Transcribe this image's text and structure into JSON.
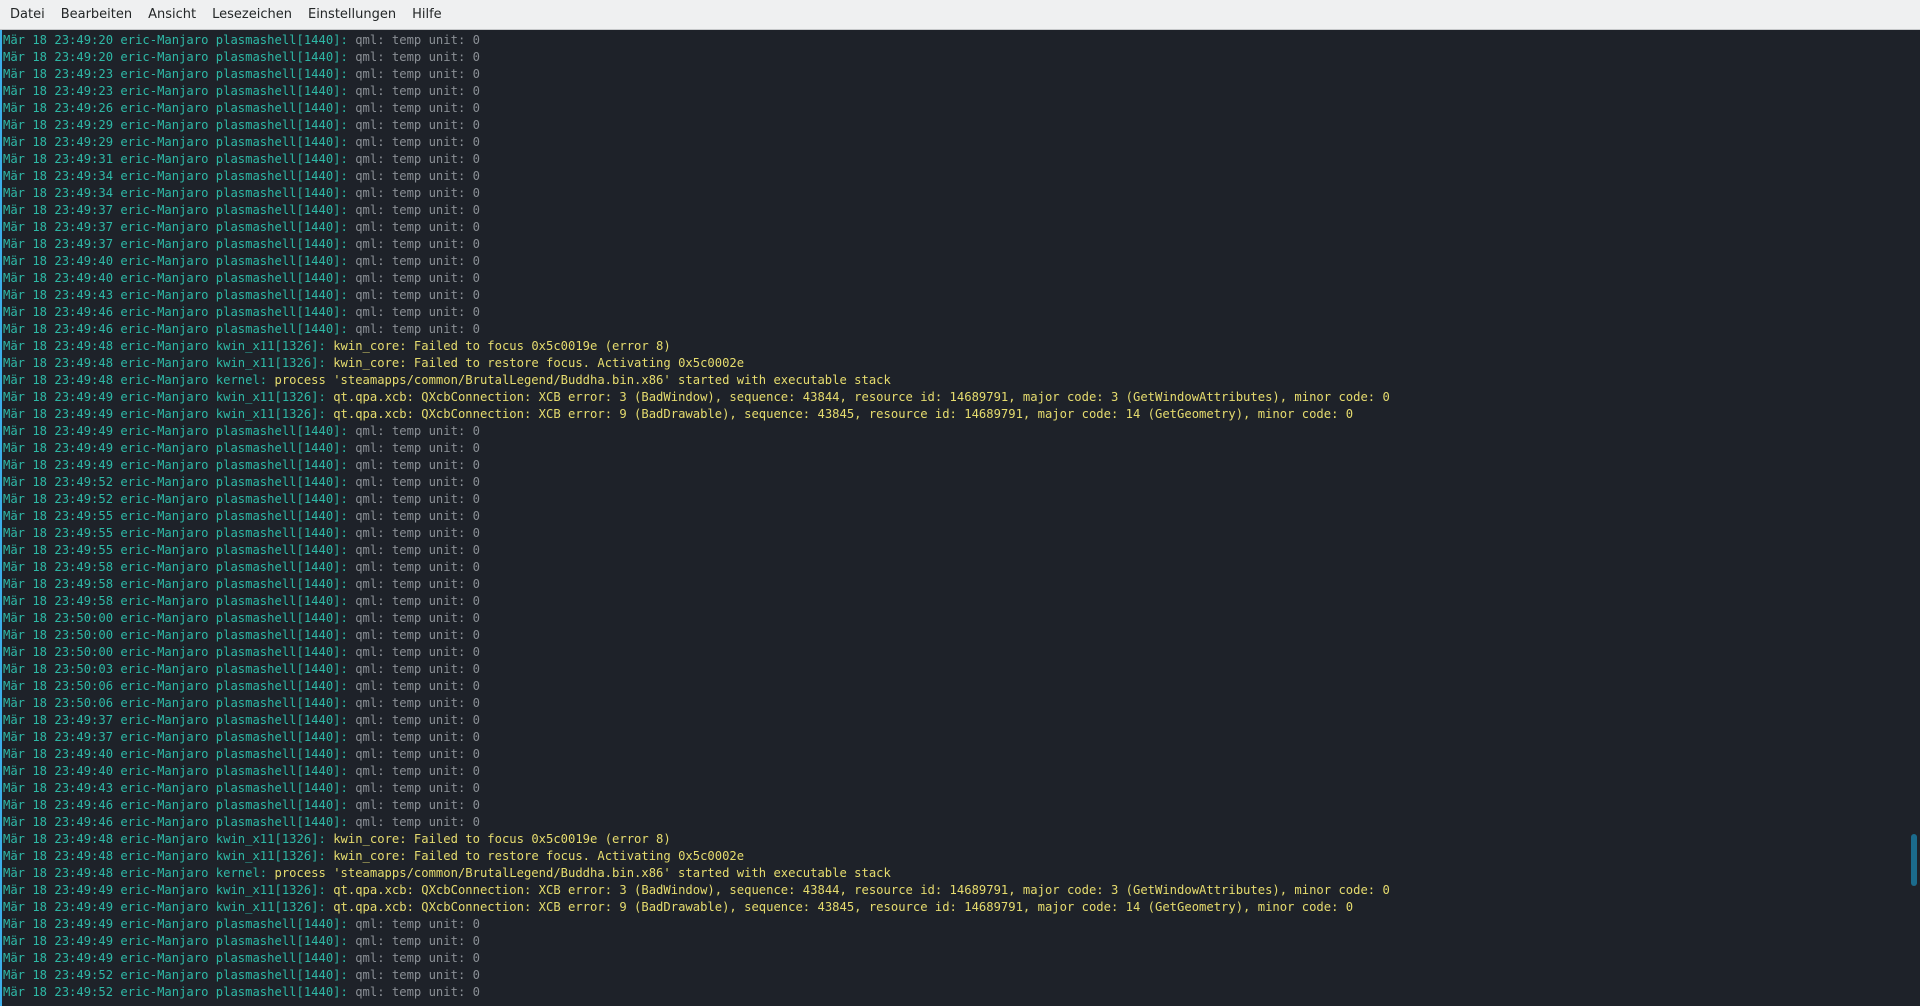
{
  "menubar": {
    "items": [
      "Datei",
      "Bearbeiten",
      "Ansicht",
      "Lesezeichen",
      "Einstellungen",
      "Hilfe"
    ]
  },
  "colors": {
    "background": "#1e2229",
    "host": "#2eb8a6",
    "info": "#8a8f95",
    "warning": "#e6dc6e"
  },
  "log_lines": [
    {
      "prefix": "Mär 18 23:49:20 eric-Manjaro plasmashell[1440]:",
      "msg": "qml: temp unit: 0",
      "level": "info"
    },
    {
      "prefix": "Mär 18 23:49:20 eric-Manjaro plasmashell[1440]:",
      "msg": "qml: temp unit: 0",
      "level": "info"
    },
    {
      "prefix": "Mär 18 23:49:23 eric-Manjaro plasmashell[1440]:",
      "msg": "qml: temp unit: 0",
      "level": "info"
    },
    {
      "prefix": "Mär 18 23:49:23 eric-Manjaro plasmashell[1440]:",
      "msg": "qml: temp unit: 0",
      "level": "info"
    },
    {
      "prefix": "Mär 18 23:49:26 eric-Manjaro plasmashell[1440]:",
      "msg": "qml: temp unit: 0",
      "level": "info"
    },
    {
      "prefix": "Mär 18 23:49:29 eric-Manjaro plasmashell[1440]:",
      "msg": "qml: temp unit: 0",
      "level": "info"
    },
    {
      "prefix": "Mär 18 23:49:29 eric-Manjaro plasmashell[1440]:",
      "msg": "qml: temp unit: 0",
      "level": "info"
    },
    {
      "prefix": "Mär 18 23:49:31 eric-Manjaro plasmashell[1440]:",
      "msg": "qml: temp unit: 0",
      "level": "info"
    },
    {
      "prefix": "Mär 18 23:49:34 eric-Manjaro plasmashell[1440]:",
      "msg": "qml: temp unit: 0",
      "level": "info"
    },
    {
      "prefix": "Mär 18 23:49:34 eric-Manjaro plasmashell[1440]:",
      "msg": "qml: temp unit: 0",
      "level": "info"
    },
    {
      "prefix": "Mär 18 23:49:37 eric-Manjaro plasmashell[1440]:",
      "msg": "qml: temp unit: 0",
      "level": "info"
    },
    {
      "prefix": "Mär 18 23:49:37 eric-Manjaro plasmashell[1440]:",
      "msg": "qml: temp unit: 0",
      "level": "info"
    },
    {
      "prefix": "Mär 18 23:49:37 eric-Manjaro plasmashell[1440]:",
      "msg": "qml: temp unit: 0",
      "level": "info"
    },
    {
      "prefix": "Mär 18 23:49:40 eric-Manjaro plasmashell[1440]:",
      "msg": "qml: temp unit: 0",
      "level": "info"
    },
    {
      "prefix": "Mär 18 23:49:40 eric-Manjaro plasmashell[1440]:",
      "msg": "qml: temp unit: 0",
      "level": "info"
    },
    {
      "prefix": "Mär 18 23:49:43 eric-Manjaro plasmashell[1440]:",
      "msg": "qml: temp unit: 0",
      "level": "info"
    },
    {
      "prefix": "Mär 18 23:49:46 eric-Manjaro plasmashell[1440]:",
      "msg": "qml: temp unit: 0",
      "level": "info"
    },
    {
      "prefix": "Mär 18 23:49:46 eric-Manjaro plasmashell[1440]:",
      "msg": "qml: temp unit: 0",
      "level": "info"
    },
    {
      "prefix": "Mär 18 23:49:48 eric-Manjaro kwin_x11[1326]:",
      "msg": "kwin_core: Failed to focus 0x5c0019e (error 8)",
      "level": "warn"
    },
    {
      "prefix": "Mär 18 23:49:48 eric-Manjaro kwin_x11[1326]:",
      "msg": "kwin_core: Failed to restore focus. Activating 0x5c0002e",
      "level": "warn"
    },
    {
      "prefix": "Mär 18 23:49:48 eric-Manjaro kernel:",
      "msg": "process 'steamapps/common/BrutalLegend/Buddha.bin.x86' started with executable stack",
      "level": "warn"
    },
    {
      "prefix": "Mär 18 23:49:49 eric-Manjaro kwin_x11[1326]:",
      "msg": "qt.qpa.xcb: QXcbConnection: XCB error: 3 (BadWindow), sequence: 43844, resource id: 14689791, major code: 3 (GetWindowAttributes), minor code: 0",
      "level": "warn"
    },
    {
      "prefix": "Mär 18 23:49:49 eric-Manjaro kwin_x11[1326]:",
      "msg": "qt.qpa.xcb: QXcbConnection: XCB error: 9 (BadDrawable), sequence: 43845, resource id: 14689791, major code: 14 (GetGeometry), minor code: 0",
      "level": "warn"
    },
    {
      "prefix": "Mär 18 23:49:49 eric-Manjaro plasmashell[1440]:",
      "msg": "qml: temp unit: 0",
      "level": "info"
    },
    {
      "prefix": "Mär 18 23:49:49 eric-Manjaro plasmashell[1440]:",
      "msg": "qml: temp unit: 0",
      "level": "info"
    },
    {
      "prefix": "Mär 18 23:49:49 eric-Manjaro plasmashell[1440]:",
      "msg": "qml: temp unit: 0",
      "level": "info"
    },
    {
      "prefix": "Mär 18 23:49:52 eric-Manjaro plasmashell[1440]:",
      "msg": "qml: temp unit: 0",
      "level": "info"
    },
    {
      "prefix": "Mär 18 23:49:52 eric-Manjaro plasmashell[1440]:",
      "msg": "qml: temp unit: 0",
      "level": "info"
    },
    {
      "prefix": "Mär 18 23:49:55 eric-Manjaro plasmashell[1440]:",
      "msg": "qml: temp unit: 0",
      "level": "info"
    },
    {
      "prefix": "Mär 18 23:49:55 eric-Manjaro plasmashell[1440]:",
      "msg": "qml: temp unit: 0",
      "level": "info"
    },
    {
      "prefix": "Mär 18 23:49:55 eric-Manjaro plasmashell[1440]:",
      "msg": "qml: temp unit: 0",
      "level": "info"
    },
    {
      "prefix": "Mär 18 23:49:58 eric-Manjaro plasmashell[1440]:",
      "msg": "qml: temp unit: 0",
      "level": "info"
    },
    {
      "prefix": "Mär 18 23:49:58 eric-Manjaro plasmashell[1440]:",
      "msg": "qml: temp unit: 0",
      "level": "info"
    },
    {
      "prefix": "Mär 18 23:49:58 eric-Manjaro plasmashell[1440]:",
      "msg": "qml: temp unit: 0",
      "level": "info"
    },
    {
      "prefix": "Mär 18 23:50:00 eric-Manjaro plasmashell[1440]:",
      "msg": "qml: temp unit: 0",
      "level": "info"
    },
    {
      "prefix": "Mär 18 23:50:00 eric-Manjaro plasmashell[1440]:",
      "msg": "qml: temp unit: 0",
      "level": "info"
    },
    {
      "prefix": "Mär 18 23:50:00 eric-Manjaro plasmashell[1440]:",
      "msg": "qml: temp unit: 0",
      "level": "info"
    },
    {
      "prefix": "Mär 18 23:50:03 eric-Manjaro plasmashell[1440]:",
      "msg": "qml: temp unit: 0",
      "level": "info"
    },
    {
      "prefix": "Mär 18 23:50:06 eric-Manjaro plasmashell[1440]:",
      "msg": "qml: temp unit: 0",
      "level": "info"
    },
    {
      "prefix": "Mär 18 23:50:06 eric-Manjaro plasmashell[1440]:",
      "msg": "qml: temp unit: 0",
      "level": "info"
    },
    {
      "prefix": "Mär 18 23:49:37 eric-Manjaro plasmashell[1440]:",
      "msg": "qml: temp unit: 0",
      "level": "info"
    },
    {
      "prefix": "Mär 18 23:49:37 eric-Manjaro plasmashell[1440]:",
      "msg": "qml: temp unit: 0",
      "level": "info"
    },
    {
      "prefix": "Mär 18 23:49:40 eric-Manjaro plasmashell[1440]:",
      "msg": "qml: temp unit: 0",
      "level": "info"
    },
    {
      "prefix": "Mär 18 23:49:40 eric-Manjaro plasmashell[1440]:",
      "msg": "qml: temp unit: 0",
      "level": "info"
    },
    {
      "prefix": "Mär 18 23:49:43 eric-Manjaro plasmashell[1440]:",
      "msg": "qml: temp unit: 0",
      "level": "info"
    },
    {
      "prefix": "Mär 18 23:49:46 eric-Manjaro plasmashell[1440]:",
      "msg": "qml: temp unit: 0",
      "level": "info"
    },
    {
      "prefix": "Mär 18 23:49:46 eric-Manjaro plasmashell[1440]:",
      "msg": "qml: temp unit: 0",
      "level": "info"
    },
    {
      "prefix": "Mär 18 23:49:48 eric-Manjaro kwin_x11[1326]:",
      "msg": "kwin_core: Failed to focus 0x5c0019e (error 8)",
      "level": "warn"
    },
    {
      "prefix": "Mär 18 23:49:48 eric-Manjaro kwin_x11[1326]:",
      "msg": "kwin_core: Failed to restore focus. Activating 0x5c0002e",
      "level": "warn"
    },
    {
      "prefix": "Mär 18 23:49:48 eric-Manjaro kernel:",
      "msg": "process 'steamapps/common/BrutalLegend/Buddha.bin.x86' started with executable stack",
      "level": "warn"
    },
    {
      "prefix": "Mär 18 23:49:49 eric-Manjaro kwin_x11[1326]:",
      "msg": "qt.qpa.xcb: QXcbConnection: XCB error: 3 (BadWindow), sequence: 43844, resource id: 14689791, major code: 3 (GetWindowAttributes), minor code: 0",
      "level": "warn"
    },
    {
      "prefix": "Mär 18 23:49:49 eric-Manjaro kwin_x11[1326]:",
      "msg": "qt.qpa.xcb: QXcbConnection: XCB error: 9 (BadDrawable), sequence: 43845, resource id: 14689791, major code: 14 (GetGeometry), minor code: 0",
      "level": "warn"
    },
    {
      "prefix": "Mär 18 23:49:49 eric-Manjaro plasmashell[1440]:",
      "msg": "qml: temp unit: 0",
      "level": "info"
    },
    {
      "prefix": "Mär 18 23:49:49 eric-Manjaro plasmashell[1440]:",
      "msg": "qml: temp unit: 0",
      "level": "info"
    },
    {
      "prefix": "Mär 18 23:49:49 eric-Manjaro plasmashell[1440]:",
      "msg": "qml: temp unit: 0",
      "level": "info"
    },
    {
      "prefix": "Mär 18 23:49:52 eric-Manjaro plasmashell[1440]:",
      "msg": "qml: temp unit: 0",
      "level": "info"
    },
    {
      "prefix": "Mär 18 23:49:52 eric-Manjaro plasmashell[1440]:",
      "msg": "qml: temp unit: 0",
      "level": "info"
    }
  ]
}
